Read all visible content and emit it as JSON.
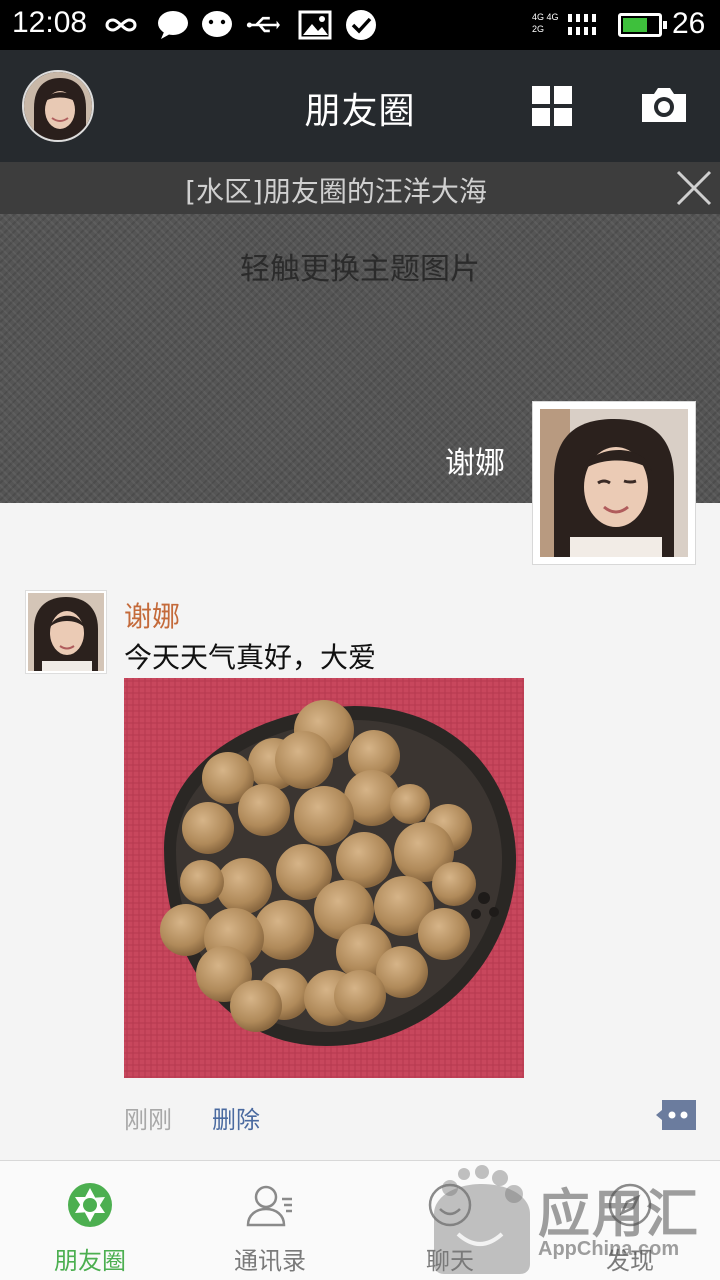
{
  "status_bar": {
    "time": "12:08",
    "network_top": "4G 4G",
    "network_bottom": "2G",
    "battery_level": 0.7,
    "battery_text": "26",
    "icons": [
      "infinity-icon",
      "chat-bubble-icon",
      "wechat-icon",
      "usb-icon",
      "image-icon",
      "check-circle-icon",
      "signal-icon",
      "battery-icon"
    ]
  },
  "header": {
    "title": "朋友圈",
    "icons": [
      "avatar",
      "grid-icon",
      "camera-icon"
    ]
  },
  "banner": {
    "text": "[水区]朋友圈的汪洋大海",
    "close_icon": "close-icon"
  },
  "cover": {
    "hint": "轻触更换主题图片",
    "user_name": "谢娜"
  },
  "post": {
    "author": "谢娜",
    "text": "今天天气真好，大爱",
    "time": "刚刚",
    "delete_label": "删除",
    "comment_icon": "comment-icon",
    "image_description_icon": "longan-plate-photo"
  },
  "nav": {
    "items": [
      {
        "label": "朋友圈",
        "icon": "moments-shutter-icon",
        "active": true
      },
      {
        "label": "通讯录",
        "icon": "contacts-icon",
        "active": false
      },
      {
        "label": "聊天",
        "icon": "chat-face-icon",
        "active": false
      },
      {
        "label": "发现",
        "icon": "discover-icon",
        "active": false
      }
    ]
  },
  "watermark": {
    "title": "应用汇",
    "subtitle": "AppChina.com"
  },
  "colors": {
    "accent_green": "#4caf50",
    "name_orange": "#c46a3a",
    "link_blue": "#4a6aa0",
    "titlebar": "#262a2e"
  }
}
